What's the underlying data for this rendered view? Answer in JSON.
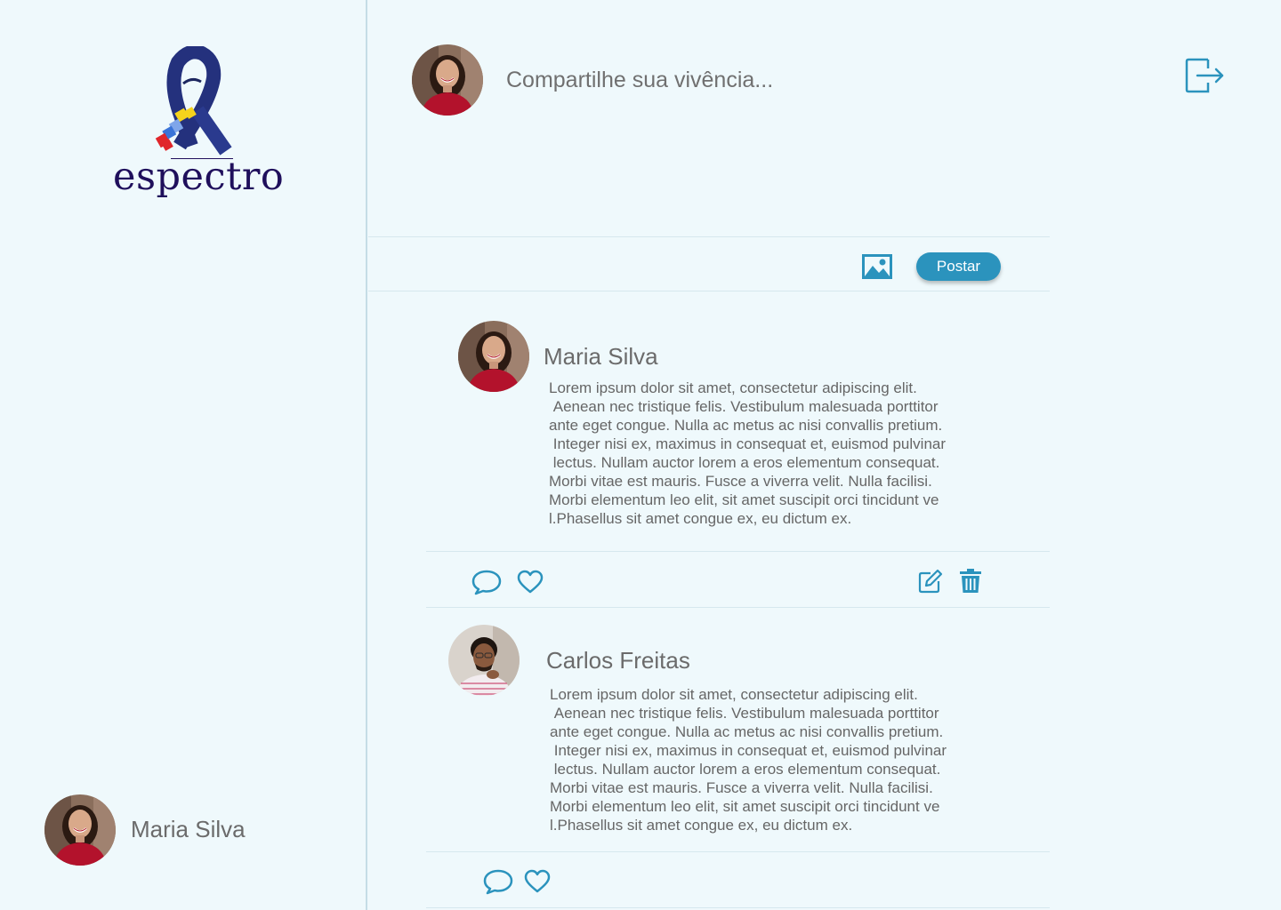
{
  "app": {
    "logo_text": "espectro"
  },
  "colors": {
    "background": "#eff9fc",
    "accent": "#2b93bd",
    "logo_text": "#1f0f5c"
  },
  "composer": {
    "placeholder": "Compartilhe sua vivência...",
    "value": "",
    "post_label": "Postar",
    "image_icon": "image-icon",
    "logout_icon": "logout-icon"
  },
  "sidebar": {
    "user_name": "Maria Silva"
  },
  "posts": [
    {
      "author": "Maria Silva",
      "body": "Lorem ipsum dolor sit amet, consectetur adipiscing elit.\n Aenean nec tristique felis. Vestibulum malesuada porttitor\nante eget congue. Nulla ac metus ac nisi convallis pretium.\n Integer nisi ex, maximus in consequat et, euismod pulvinar\n lectus. Nullam auctor lorem a eros elementum consequat.\nMorbi vitae est mauris. Fusce a viverra velit. Nulla facilisi.\nMorbi elementum leo elit, sit amet suscipit orci tincidunt ve\nl.Phasellus sit amet congue ex, eu dictum ex.",
      "actions": [
        "comment-icon",
        "heart-icon",
        "edit-icon",
        "trash-icon"
      ]
    },
    {
      "author": "Carlos Freitas",
      "body": "Lorem ipsum dolor sit amet, consectetur adipiscing elit.\n Aenean nec tristique felis. Vestibulum malesuada porttitor\nante eget congue. Nulla ac metus ac nisi convallis pretium.\n Integer nisi ex, maximus in consequat et, euismod pulvinar\n lectus. Nullam auctor lorem a eros elementum consequat.\nMorbi vitae est mauris. Fusce a viverra velit. Nulla facilisi.\nMorbi elementum leo elit, sit amet suscipit orci tincidunt ve\nl.Phasellus sit amet congue ex, eu dictum ex.",
      "actions": [
        "comment-icon",
        "heart-icon"
      ]
    }
  ]
}
